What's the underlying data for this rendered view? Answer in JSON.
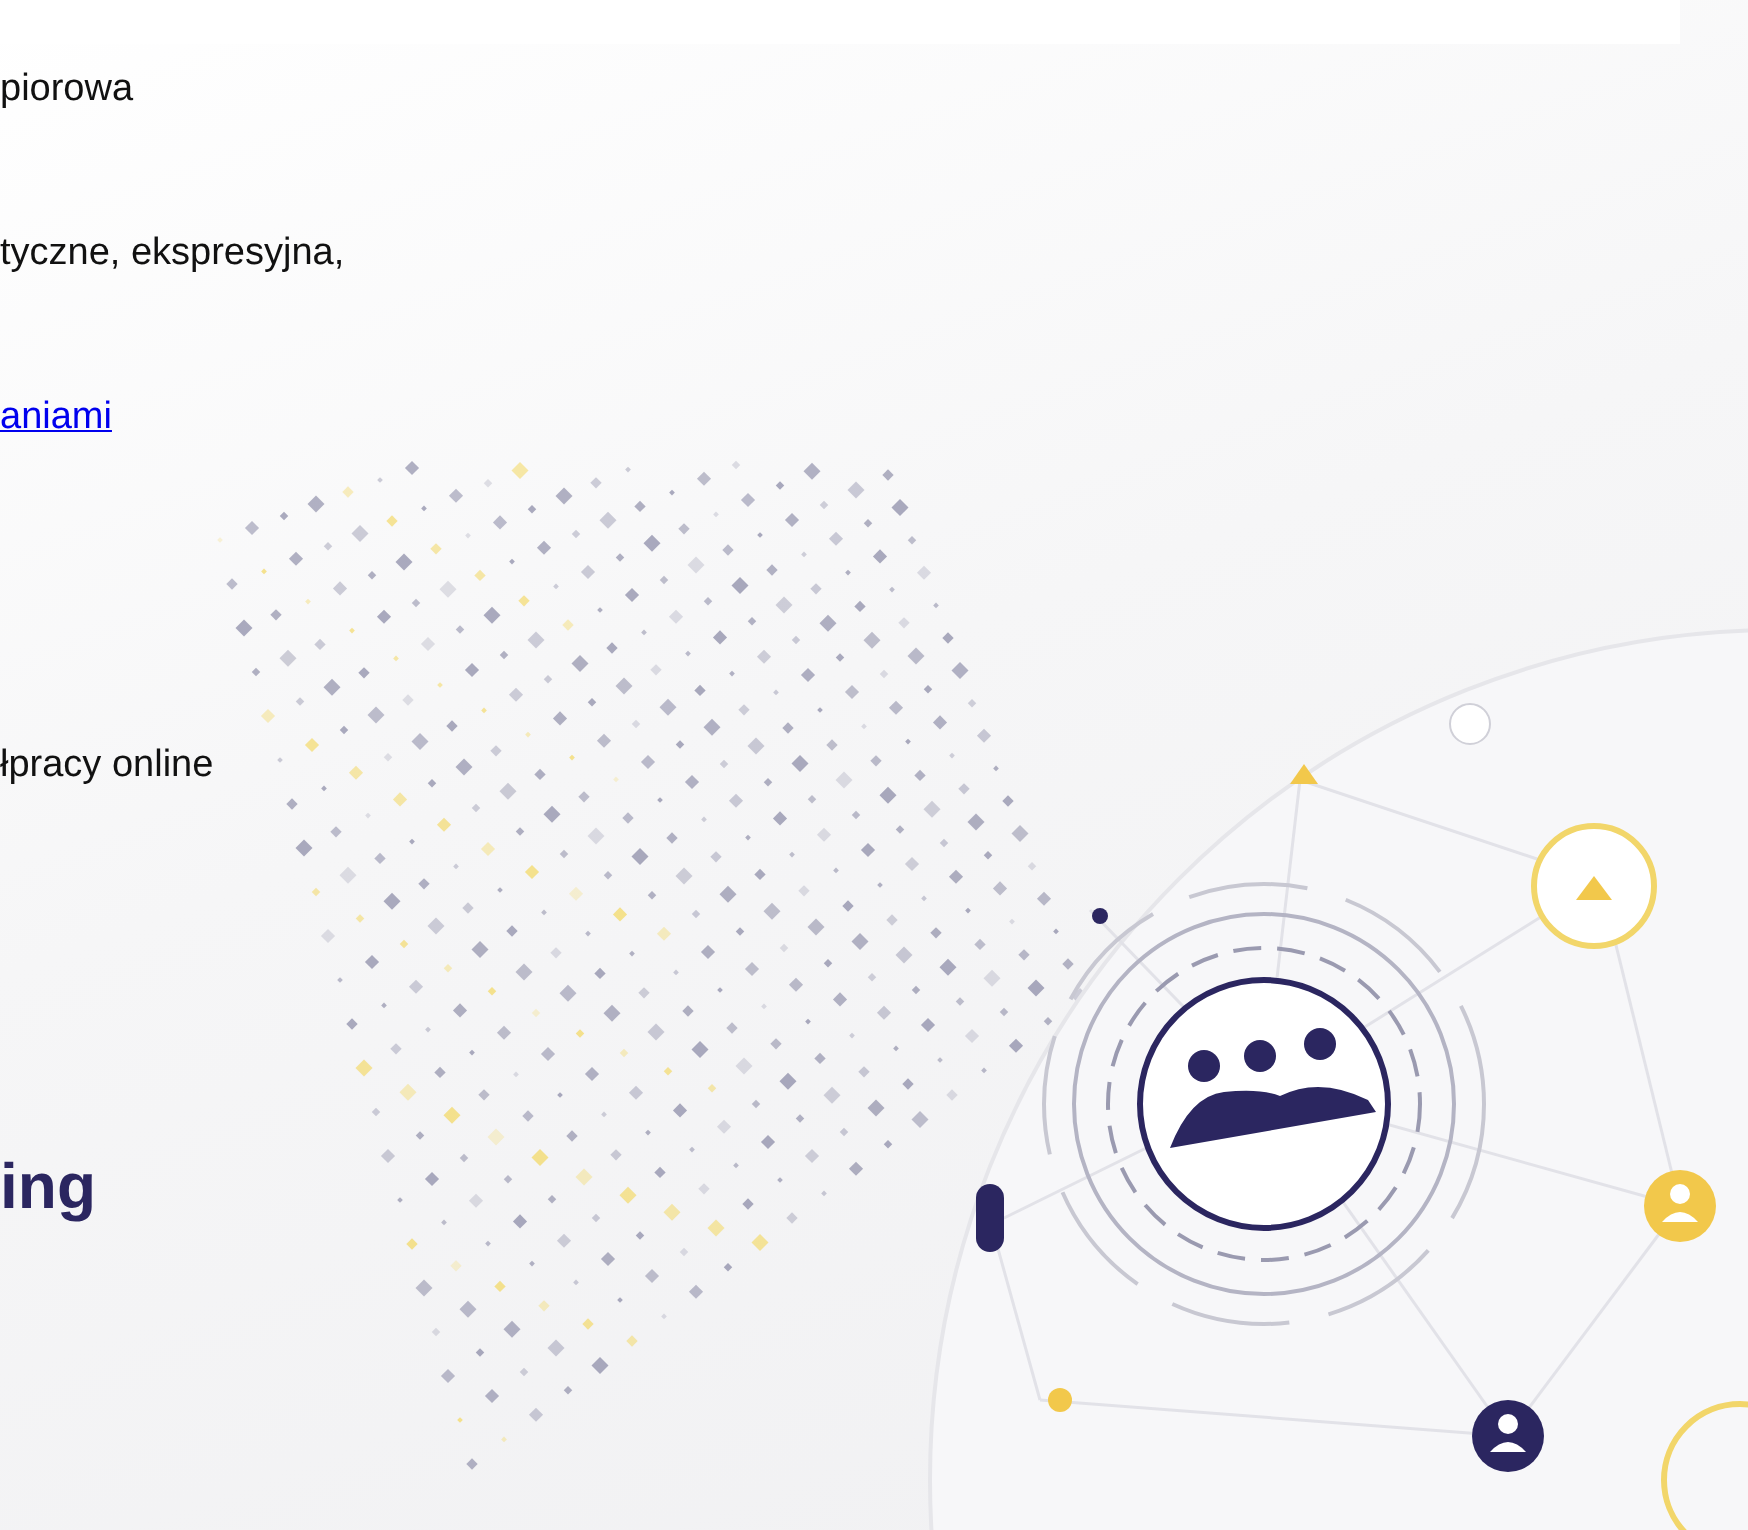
{
  "lines": [
    {
      "kind": "text",
      "text": "piorowa"
    },
    {
      "kind": "text",
      "text": "tyczne, ekspresyjna,"
    },
    {
      "kind": "link",
      "text": "aniami"
    },
    {
      "kind": "text",
      "text": "łpracy online"
    }
  ],
  "heading": "ing"
}
